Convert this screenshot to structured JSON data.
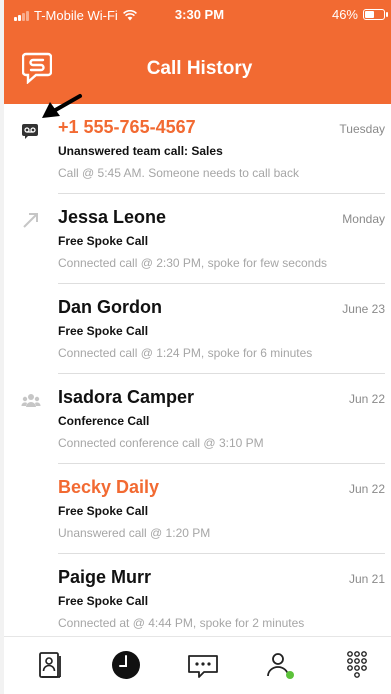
{
  "status_bar": {
    "carrier": "T-Mobile Wi-Fi",
    "time": "3:30 PM",
    "battery": "46%"
  },
  "header": {
    "title": "Call History"
  },
  "calls": [
    {
      "name": "+1 555-765-4567",
      "date": "Tuesday",
      "type": "Unanswered team call: Sales",
      "detail": "Call @ 5:45 AM. Someone needs to call back",
      "icon": "voicemail-icon",
      "missed": true
    },
    {
      "name": "Jessa Leone",
      "date": "Monday",
      "type": "Free Spoke Call",
      "detail": "Connected call @ 2:30 PM, spoke for few seconds",
      "icon": "outgoing-call-icon",
      "missed": false
    },
    {
      "name": "Dan Gordon",
      "date": "June 23",
      "type": "Free Spoke Call",
      "detail": "Connected call @ 1:24 PM, spoke for 6 minutes",
      "icon": "",
      "missed": false
    },
    {
      "name": "Isadora Camper",
      "date": "Jun 22",
      "type": "Conference Call",
      "detail": "Connected conference call @ 3:10 PM",
      "icon": "conference-icon",
      "missed": false
    },
    {
      "name": "Becky Daily",
      "date": "Jun 22",
      "type": "Free Spoke Call",
      "detail": "Unanswered call @ 1:20 PM",
      "icon": "",
      "missed": true
    },
    {
      "name": "Paige Murr",
      "date": "Jun 21",
      "type": "Free Spoke Call",
      "detail": "Connected at @ 4:44 PM, spoke for 2 minutes",
      "icon": "",
      "missed": false
    }
  ],
  "tabs": [
    {
      "icon": "contacts-icon"
    },
    {
      "icon": "history-clock-icon",
      "active": true
    },
    {
      "icon": "messages-icon"
    },
    {
      "icon": "profile-icon"
    },
    {
      "icon": "dialpad-icon"
    }
  ],
  "colors": {
    "brand": "#f26a32",
    "status_online": "#5cc23a",
    "muted_text": "#a6a6a6"
  }
}
